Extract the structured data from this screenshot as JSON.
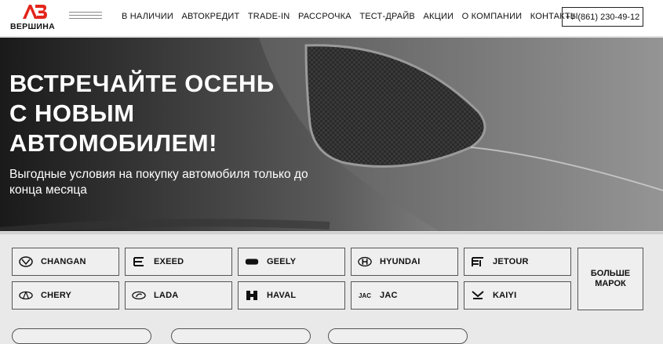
{
  "header": {
    "logo_text": "ВЕРШИНА",
    "nav": [
      "В НАЛИЧИИ",
      "АВТОКРЕДИТ",
      "TRADE-IN",
      "РАССРОЧКА",
      "ТЕСТ-ДРАЙВ",
      "АКЦИИ",
      "О КОМПАНИИ",
      "КОНТАКТЫ"
    ],
    "phone": "+7 (861) 230-49-12"
  },
  "hero": {
    "title_line1": "ВСТРЕЧАЙТЕ ОСЕНЬ",
    "title_line2": "С НОВЫМ",
    "title_line3": "АВТОМОБИЛЕМ!",
    "subtitle": "Выгодные условия на покупку автомобиля только до конца месяца"
  },
  "brands": {
    "items": [
      {
        "label": "CHANGAN",
        "icon": "changan-icon"
      },
      {
        "label": "EXEED",
        "icon": "exeed-icon"
      },
      {
        "label": "GEELY",
        "icon": "geely-icon"
      },
      {
        "label": "HYUNDAI",
        "icon": "hyundai-icon"
      },
      {
        "label": "JETOUR",
        "icon": "jetour-icon"
      },
      {
        "label": "CHERY",
        "icon": "chery-icon"
      },
      {
        "label": "LADA",
        "icon": "lada-icon"
      },
      {
        "label": "HAVAL",
        "icon": "haval-icon"
      },
      {
        "label": "JAC",
        "icon": "jac-icon",
        "icon_text": "JAC"
      },
      {
        "label": "KAIYI",
        "icon": "kaiyi-icon"
      }
    ],
    "more_line1": "БОЛЬШЕ",
    "more_line2": "МАРОК"
  },
  "colors": {
    "brand_red": "#e3251b",
    "accent_dark": "#111111"
  }
}
